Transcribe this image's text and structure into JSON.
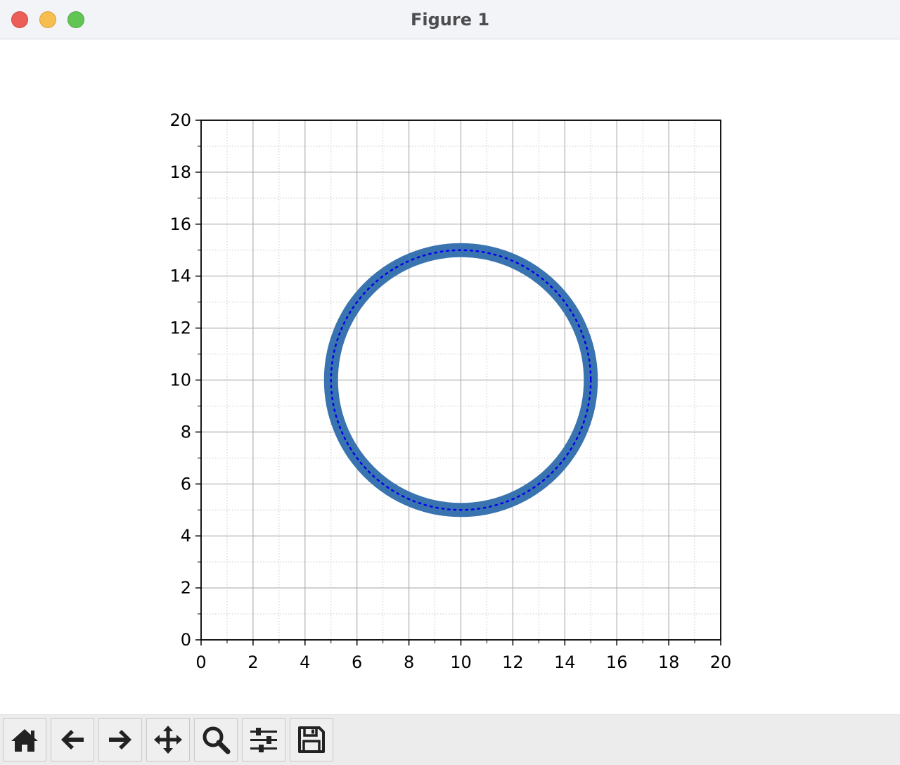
{
  "window": {
    "title": "Figure 1"
  },
  "toolbar": {
    "buttons": [
      {
        "name": "home",
        "icon": "home-icon"
      },
      {
        "name": "back",
        "icon": "arrow-left-icon"
      },
      {
        "name": "forward",
        "icon": "arrow-right-icon"
      },
      {
        "name": "pan",
        "icon": "move-icon"
      },
      {
        "name": "zoom",
        "icon": "magnifier-icon"
      },
      {
        "name": "configure-subplots",
        "icon": "sliders-icon"
      },
      {
        "name": "save",
        "icon": "floppy-disk-icon"
      }
    ]
  },
  "colors": {
    "ring": "#3a74b0",
    "dotted_circle": "#0000ee",
    "major_grid": "#b0b0b0",
    "minor_grid": "#c8c8c8"
  },
  "chart_data": {
    "type": "scatter",
    "title": "",
    "xlabel": "",
    "ylabel": "",
    "xlim": [
      0,
      20
    ],
    "ylim": [
      0,
      20
    ],
    "xticks": [
      "0",
      "2",
      "4",
      "6",
      "8",
      "10",
      "12",
      "14",
      "16",
      "18",
      "20"
    ],
    "yticks": [
      "0",
      "2",
      "4",
      "6",
      "8",
      "10",
      "12",
      "14",
      "16",
      "18",
      "20"
    ],
    "grid": {
      "major": true,
      "minor": true,
      "minor_style": "dotted"
    },
    "series": [
      {
        "kind": "thick-ring",
        "center": [
          10,
          10
        ],
        "radius": 5,
        "color": "#3a74b0"
      },
      {
        "kind": "dotted-circle",
        "center": [
          10,
          10
        ],
        "radius": 5,
        "color": "#0000ee"
      }
    ]
  }
}
